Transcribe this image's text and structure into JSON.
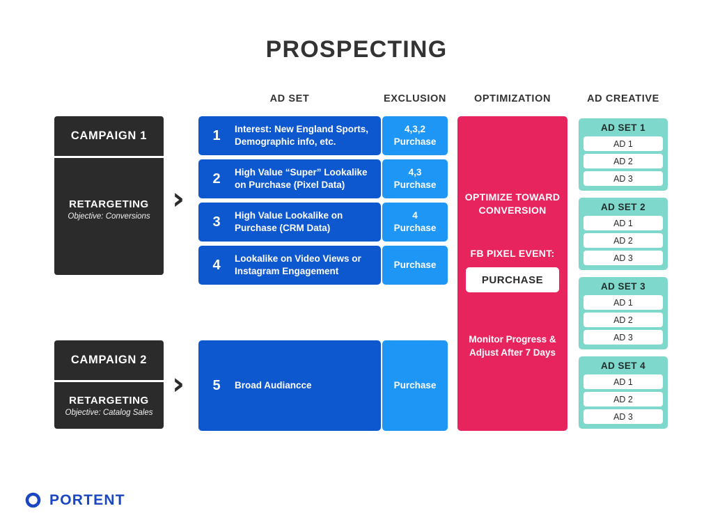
{
  "title": "PROSPECTING",
  "colors": {
    "dark": "#2b2b2b",
    "ad_set_blue": "#0d57cf",
    "exclusion_blue": "#1e96f5",
    "optimization_crimson": "#e8245f",
    "creative_teal": "#7ed8cc",
    "logo_blue": "#1b46c2"
  },
  "headers": {
    "ad_set": "AD SET",
    "exclusion": "EXCLUSION",
    "optimization": "OPTIMIZATION",
    "ad_creative": "AD CREATIVE"
  },
  "campaigns": [
    {
      "name": "CAMPAIGN 1",
      "type": "RETARGETING",
      "objective": "Objective: Conversions",
      "arrow": "›"
    },
    {
      "name": "CAMPAIGN 2",
      "type": "RETARGETING",
      "objective": "Objective: Catalog Sales",
      "arrow": "›"
    }
  ],
  "ad_sets": [
    {
      "number": "1",
      "description": "Interest: New England Sports, Demographic info, etc.",
      "exclusion": "4,3,2\nPurchase"
    },
    {
      "number": "2",
      "description": "High Value “Super” Lookalike on Purchase (Pixel Data)",
      "exclusion": "4,3\nPurchase"
    },
    {
      "number": "3",
      "description": "High Value Lookalike on Purchase (CRM Data)",
      "exclusion": "4\nPurchase"
    },
    {
      "number": "4",
      "description": "Lookalike on Video Views or Instagram Engagement",
      "exclusion": "Purchase"
    },
    {
      "number": "5",
      "description": "Broad Audiancce",
      "exclusion": "Purchase"
    }
  ],
  "optimization": {
    "headline": "OPTIMIZE TOWARD CONVERSION",
    "event_label": "FB PIXEL EVENT:",
    "event_value": "PURCHASE",
    "footnote": "Monitor Progress & Adjust After 7 Days"
  },
  "ad_creative_groups": [
    {
      "title": "AD SET 1",
      "ads": [
        "AD 1",
        "AD 2",
        "AD 3"
      ]
    },
    {
      "title": "AD SET 2",
      "ads": [
        "AD 1",
        "AD 2",
        "AD 3"
      ]
    },
    {
      "title": "AD SET 3",
      "ads": [
        "AD 1",
        "AD 2",
        "AD 3"
      ]
    },
    {
      "title": "AD SET 4",
      "ads": [
        "AD 1",
        "AD 2",
        "AD 3"
      ]
    }
  ],
  "footer": {
    "brand": "PORTENT",
    "mark": "portent-circle-icon"
  }
}
